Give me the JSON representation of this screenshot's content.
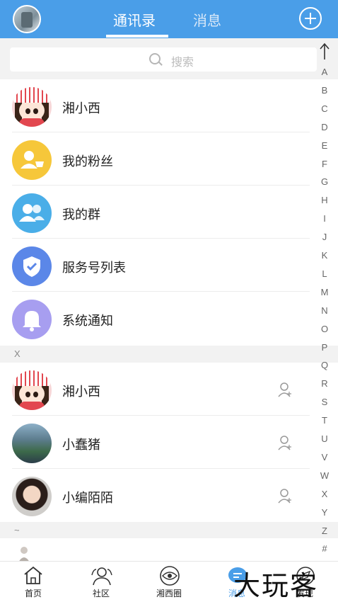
{
  "header": {
    "tabs": [
      {
        "label": "通讯录",
        "active": true
      },
      {
        "label": "消息",
        "active": false
      }
    ],
    "accent_color": "#4a9ee8"
  },
  "search": {
    "placeholder": "搜索"
  },
  "top_items": [
    {
      "name": "湘小西",
      "icon": "cartoon-avatar"
    },
    {
      "name": "我的粉丝",
      "icon": "fans-icon",
      "color": "#f6c73a"
    },
    {
      "name": "我的群",
      "icon": "group-icon",
      "color": "#4aaee8"
    },
    {
      "name": "服务号列表",
      "icon": "shield-check-icon",
      "color": "#5b87e8"
    },
    {
      "name": "系统通知",
      "icon": "bell-icon",
      "color": "#a79ef0"
    }
  ],
  "sections": [
    {
      "letter": "X",
      "contacts": [
        {
          "name": "湘小西",
          "avatar": "cartoon-avatar"
        },
        {
          "name": "小蠢猪",
          "avatar": "photo-avatar"
        },
        {
          "name": "小编陌陌",
          "avatar": "photo-avatar"
        }
      ]
    },
    {
      "letter": "~",
      "contacts": []
    }
  ],
  "index_letters": [
    "A",
    "B",
    "C",
    "D",
    "E",
    "F",
    "G",
    "H",
    "I",
    "J",
    "K",
    "L",
    "M",
    "N",
    "O",
    "P",
    "Q",
    "R",
    "S",
    "T",
    "U",
    "V",
    "W",
    "X",
    "Y",
    "Z",
    "#"
  ],
  "bottom_nav": [
    {
      "label": "首页",
      "icon": "home-icon"
    },
    {
      "label": "社区",
      "icon": "community-icon"
    },
    {
      "label": "湘西圈",
      "icon": "eye-circle-icon"
    },
    {
      "label": "消息",
      "icon": "message-icon"
    },
    {
      "label": "发现",
      "icon": "discover-icon"
    }
  ],
  "watermark": "大玩客"
}
